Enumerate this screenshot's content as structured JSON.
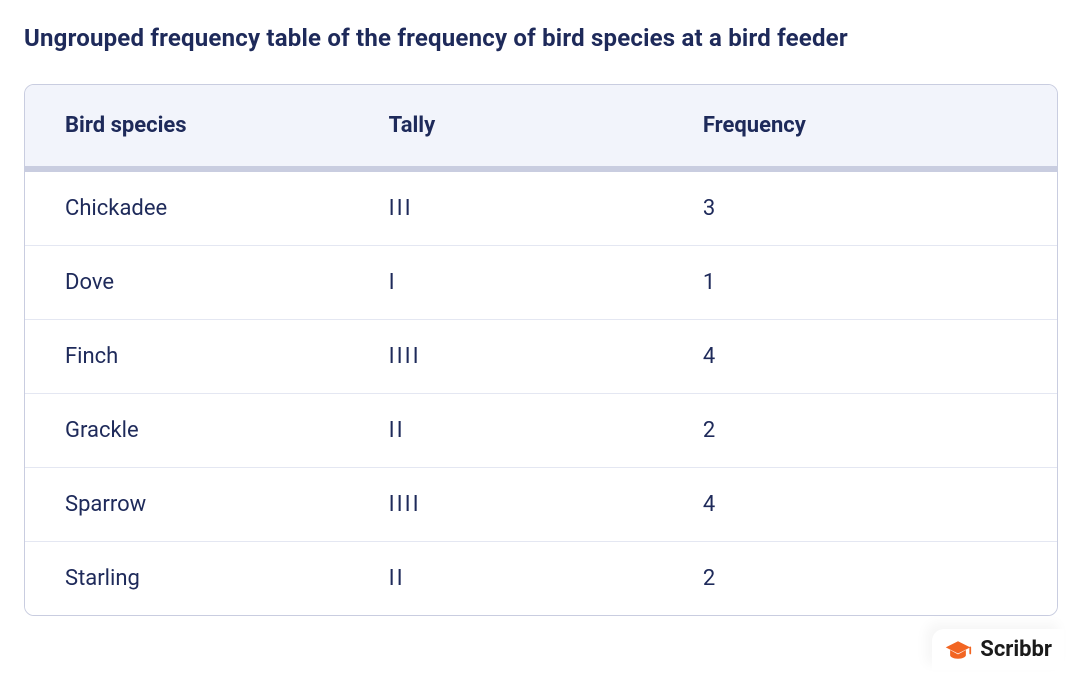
{
  "title": "Ungrouped frequency table of the frequency of bird species at a bird feeder",
  "columns": {
    "species": "Bird species",
    "tally": "Tally",
    "frequency": "Frequency"
  },
  "rows": [
    {
      "species": "Chickadee",
      "tally": "III",
      "frequency": "3"
    },
    {
      "species": "Dove",
      "tally": "I",
      "frequency": "1"
    },
    {
      "species": "Finch",
      "tally": "IIII",
      "frequency": "4"
    },
    {
      "species": "Grackle",
      "tally": "II",
      "frequency": "2"
    },
    {
      "species": "Sparrow",
      "tally": "IIII",
      "frequency": "4"
    },
    {
      "species": "Starling",
      "tally": "II",
      "frequency": "2"
    }
  ],
  "brand": "Scribbr",
  "chart_data": {
    "type": "table",
    "title": "Ungrouped frequency table of the frequency of bird species at a bird feeder",
    "categories": [
      "Chickadee",
      "Dove",
      "Finch",
      "Grackle",
      "Sparrow",
      "Starling"
    ],
    "values": [
      3,
      1,
      4,
      2,
      4,
      2
    ],
    "xlabel": "Bird species",
    "ylabel": "Frequency"
  }
}
